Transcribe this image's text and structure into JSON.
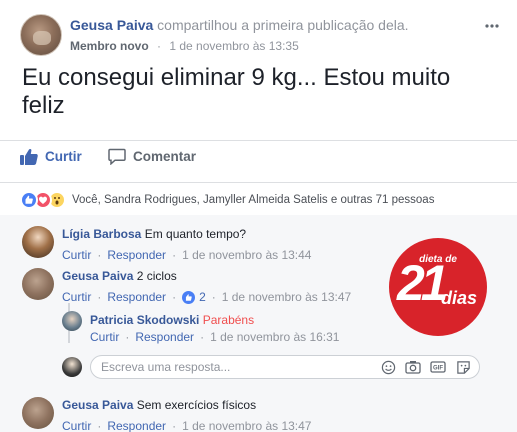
{
  "post": {
    "author": "Geusa Paiva",
    "action": "compartilhou a primeira publicação dela.",
    "badge": "Membro novo",
    "separator": "·",
    "timestamp": "1 de novembro às 13:35",
    "text": "Eu consegui eliminar 9 kg... Estou muito feliz"
  },
  "actions": {
    "like": "Curtir",
    "comment": "Comentar"
  },
  "reactions": {
    "types": [
      "like",
      "love",
      "wow"
    ],
    "text": "Você, Sandra Rodrigues, Jamyller Almeida Satelis e outras 71 pessoas"
  },
  "comments": [
    {
      "author": "Lígia Barbosa",
      "text": "Em quanto tempo?",
      "like": "Curtir",
      "reply": "Responder",
      "time": "1 de novembro às 13:44"
    },
    {
      "author": "Geusa Paiva",
      "text": "2 ciclos",
      "like": "Curtir",
      "reply": "Responder",
      "reactions": "2",
      "time": "1 de novembro às 13:47"
    },
    {
      "author": "Patricia Skodowski",
      "text": "Parabéns",
      "like": "Curtir",
      "reply": "Responder",
      "time": "1 de novembro às 16:31"
    },
    {
      "author": "Geusa Paiva",
      "text": "Sem exercícios físicos",
      "like": "Curtir",
      "reply": "Responder",
      "time": "1 de novembro às 13:47"
    }
  ],
  "reply_box": {
    "placeholder": "Escreva uma resposta..."
  },
  "logo": {
    "small": "dieta de",
    "number": "21",
    "word": "dias"
  },
  "colors": {
    "link": "#385898",
    "accent": "#4267b2",
    "muted": "#90949c",
    "logo_red": "#d8232a",
    "highlight": "#f04e4e"
  },
  "icons": [
    "more-options-icon",
    "thumbs-up-icon",
    "comment-bubble-icon",
    "emoji-icon",
    "camera-icon",
    "gif-icon",
    "sticker-icon"
  ]
}
